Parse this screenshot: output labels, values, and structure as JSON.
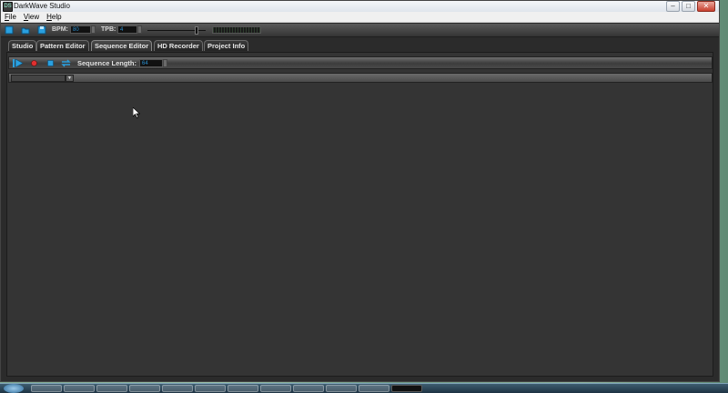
{
  "window": {
    "title": "DarkWave Studio",
    "app_icon_glyph": "DS",
    "controls": {
      "minimize": "–",
      "maximize": "□",
      "close": "✕"
    }
  },
  "menu": [
    {
      "accel": "F",
      "rest": "ile"
    },
    {
      "accel": "V",
      "rest": "iew"
    },
    {
      "accel": "H",
      "rest": "elp"
    }
  ],
  "toolbar": {
    "bpm_label": "BPM:",
    "bpm_value": "80",
    "tpb_label": "TPB:",
    "tpb_value": "4",
    "icons": [
      "new-file-icon",
      "open-folder-icon",
      "save-disk-icon"
    ],
    "accent_color": "#2aa0e0"
  },
  "tabs": [
    {
      "label": "Studio"
    },
    {
      "label": "Pattern Editor"
    },
    {
      "label": "Sequence Editor"
    },
    {
      "label": "HD Recorder"
    },
    {
      "label": "Project Info"
    }
  ],
  "active_tab": "Sequence Editor",
  "sequence_toolbar": {
    "label": "Sequence Length:",
    "length_value": "64",
    "icons": [
      "play-icon",
      "record-icon",
      "stop-icon",
      "loop-icon"
    ]
  },
  "pattern_selector": {
    "value": ""
  },
  "colors": {
    "panel_bg": "#343434",
    "record": "#e03030",
    "accent": "#2aa0e0"
  }
}
